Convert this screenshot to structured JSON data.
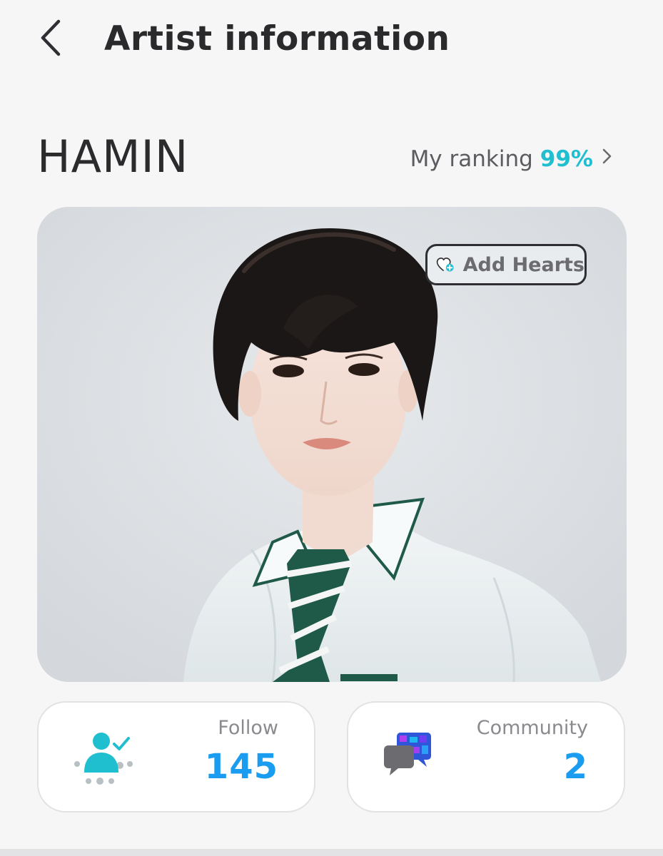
{
  "header": {
    "back_icon": "chevron-left-icon",
    "title": "Artist information"
  },
  "artist": {
    "name": "HAMIN"
  },
  "ranking": {
    "label": "My ranking",
    "value": "99%",
    "value_color": "#1fbfd0",
    "chevron_icon": "chevron-right-icon"
  },
  "photo": {
    "alt": "Artist profile photo",
    "add_hearts": {
      "icon": "heart-plus-icon",
      "label": "Add Hearts"
    }
  },
  "stats": [
    {
      "id": "follow",
      "icon": "user-check-icon",
      "label": "Follow",
      "value": "145"
    },
    {
      "id": "community",
      "icon": "chat-bubbles-icon",
      "label": "Community",
      "value": "2"
    }
  ],
  "colors": {
    "accent_blue": "#1a9df0",
    "accent_teal": "#1fbfd0",
    "background": "#f6f6f7"
  }
}
